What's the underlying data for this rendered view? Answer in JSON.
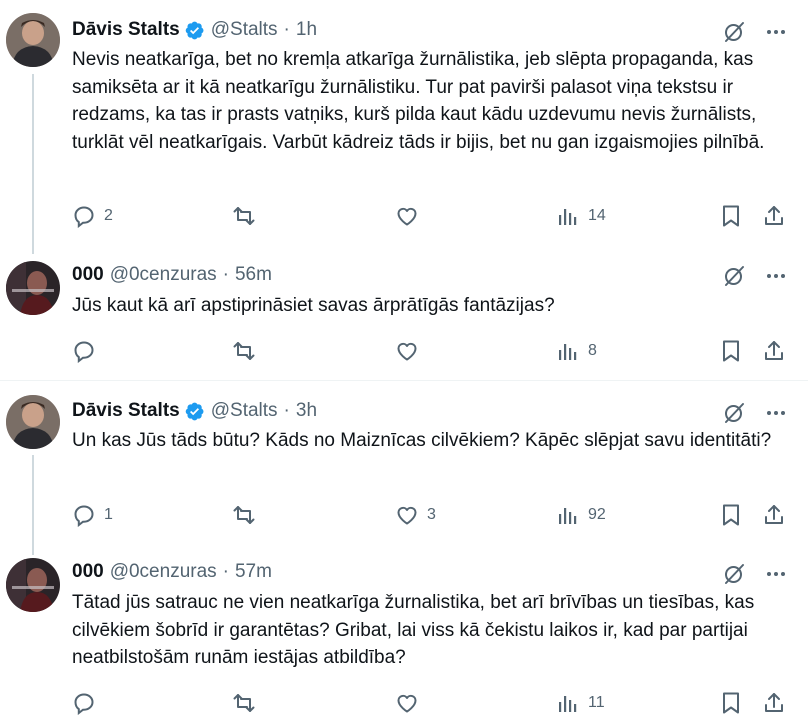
{
  "tweets": [
    {
      "name": "Dāvis Stalts",
      "verified": true,
      "handle": "@Stalts",
      "time": "1h",
      "text": "Nevis neatkarīga, bet no kremļa atkarīga žurnālistika, jeb slēpta propaganda, kas samiksēta ar it kā neatkarīgu žurnālistiku. Tur pat pavirši palasot viņa tekstsu ir redzams, ka tas ir prasts vatņiks, kurš pilda kaut kādu uzdevumu nevis žurnālists, turklāt vēl neatkarīgais. Varbūt kādreiz tāds ir bijis, bet nu gan izgaismojies pilnībā.",
      "replies": "2",
      "retweets": "",
      "likes": "",
      "views": "14"
    },
    {
      "name": "000",
      "verified": false,
      "handle": "@0cenzuras",
      "time": "56m",
      "text": "Jūs kaut kā arī apstiprināsiet savas ārprātīgās fantāzijas?",
      "replies": "",
      "retweets": "",
      "likes": "",
      "views": "8"
    },
    {
      "name": "Dāvis Stalts",
      "verified": true,
      "handle": "@Stalts",
      "time": "3h",
      "text": "Un kas Jūs tāds būtu? Kāds no Maiznīcas cilvēkiem? Kāpēc slēpjat savu identitāti?",
      "replies": "1",
      "retweets": "",
      "likes": "3",
      "views": "92"
    },
    {
      "name": "000",
      "verified": false,
      "handle": "@0cenzuras",
      "time": "57m",
      "text": "Tātad jūs satrauc ne vien neatkarīga žurnalistika, bet arī brīvības un tiesības, kas cilvēkiem šobrīd ir garantētas? Gribat, lai viss kā čekistu laikos ir, kad par partijai neatbilstošām runām iestājas atbildība?",
      "replies": "",
      "retweets": "",
      "likes": "",
      "views": "11"
    }
  ],
  "separator_dot": "·",
  "colors": {
    "text": "#0f1419",
    "secondary": "#536471",
    "verified": "#1d9bf0",
    "thread_line": "#cfd9de"
  },
  "icons": {
    "grok": "grok-icon",
    "more": "more-icon",
    "reply": "reply-icon",
    "retweet": "retweet-icon",
    "like": "like-icon",
    "views": "views-icon",
    "bookmark": "bookmark-icon",
    "share": "share-icon"
  }
}
